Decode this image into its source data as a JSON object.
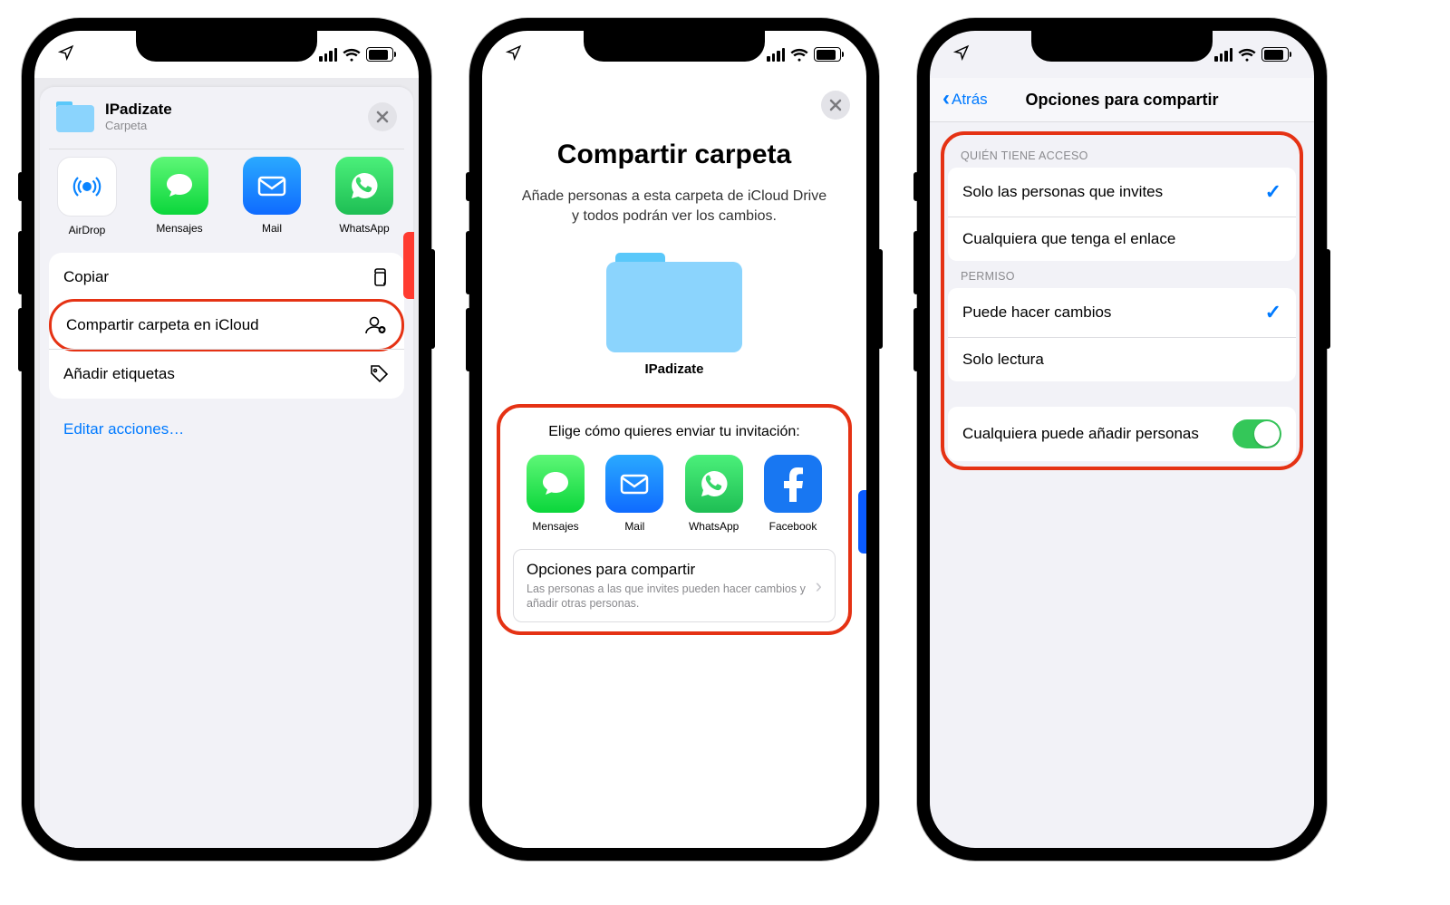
{
  "screen1": {
    "item_title": "IPadizate",
    "item_sub": "Carpeta",
    "apps": [
      "AirDrop",
      "Mensajes",
      "Mail",
      "WhatsApp"
    ],
    "actions": {
      "copy": "Copiar",
      "share_icloud": "Compartir carpeta en iCloud",
      "tags": "Añadir etiquetas"
    },
    "edit_actions": "Editar acciones…"
  },
  "screen2": {
    "title": "Compartir carpeta",
    "subtitle": "Añade personas a esta carpeta de iCloud Drive y todos podrán ver los cambios.",
    "folder_name": "IPadizate",
    "invite_prompt": "Elige cómo quieres enviar tu invitación:",
    "apps": [
      "Mensajes",
      "Mail",
      "WhatsApp",
      "Facebook"
    ],
    "options_title": "Opciones para compartir",
    "options_sub": "Las personas a las que invites pueden hacer cambios y añadir otras personas."
  },
  "screen3": {
    "back": "Atrás",
    "title": "Opciones para compartir",
    "section_access": "QUIÉN TIENE ACCESO",
    "access_invited": "Solo las personas que invites",
    "access_anyone_link": "Cualquiera que tenga el enlace",
    "section_perm": "PERMISO",
    "perm_edit": "Puede hacer cambios",
    "perm_read": "Solo lectura",
    "anyone_add": "Cualquiera puede añadir personas"
  }
}
